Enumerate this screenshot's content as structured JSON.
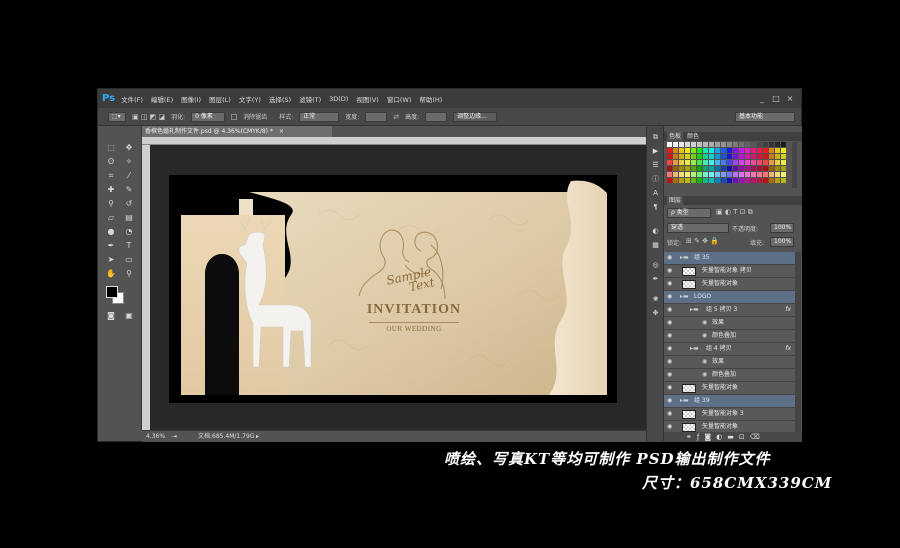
{
  "app": {
    "logo": "Ps"
  },
  "menu": [
    "文件(F)",
    "编辑(E)",
    "图像(I)",
    "图层(L)",
    "文字(Y)",
    "选择(S)",
    "滤镜(T)",
    "3D(D)",
    "视图(V)",
    "窗口(W)",
    "帮助(H)"
  ],
  "window_controls": {
    "minimize": "_",
    "maximize": "□",
    "close": "×"
  },
  "options": {
    "feather_label": "羽化:",
    "feather_value": "0 像素",
    "antialias_label": "消除锯齿",
    "style_label": "样式:",
    "style_value": "正常",
    "width_label": "宽度:",
    "height_label": "高度:",
    "refine_edge": "调整边缘...",
    "workspace": "基本功能"
  },
  "document": {
    "tab_title": "香槟色婚礼制作文件.psd @ 4.36%(CMYK/8) *",
    "zoom": "4.36%",
    "doc_info": "文档:685.4M/1.79G"
  },
  "artwork": {
    "script_line1": "Sample",
    "script_line2": "Text",
    "title": "INVITATION",
    "subtitle": "OUR WEDDING"
  },
  "color_panel": {
    "tabs": [
      "色板",
      "颜色"
    ]
  },
  "layers_panel": {
    "tab": "图层",
    "filter_kind": "ρ 类型",
    "blend_mode": "穿透",
    "opacity_label": "不透明度:",
    "opacity_value": "100%",
    "lock_label": "锁定:",
    "fill_label": "填充:",
    "fill_value": "100%",
    "layers": [
      {
        "name": "组 35",
        "type": "group",
        "selected": true
      },
      {
        "name": "矢量智能对象 拷贝",
        "type": "layer"
      },
      {
        "name": "矢量智能对象",
        "type": "layer"
      },
      {
        "name": "LOGO",
        "type": "group",
        "selected": true
      },
      {
        "name": "组 5 拷贝 3",
        "type": "group",
        "fx": "fx"
      },
      {
        "name": "效果",
        "type": "effect"
      },
      {
        "name": "颜色叠加",
        "type": "effect"
      },
      {
        "name": "组 4 拷贝",
        "type": "group",
        "fx": "fx"
      },
      {
        "name": "效果",
        "type": "effect"
      },
      {
        "name": "颜色叠加",
        "type": "effect"
      },
      {
        "name": "矢量智能对象",
        "type": "layer"
      },
      {
        "name": "组 39",
        "type": "group",
        "selected": true
      },
      {
        "name": "矢量智能对象 3",
        "type": "layer"
      },
      {
        "name": "矢量智能对象",
        "type": "layer"
      }
    ]
  },
  "footer": {
    "line1": "喷绘、写真KT等均可制作  PSD输出制作文件",
    "line2": "尺寸：658CMX339CM"
  },
  "colors": {
    "ps_blue": "#31a8ff",
    "champagne": "#e2cfae",
    "gold_text": "#8a6a3c",
    "selected_layer": "#5e6f88"
  }
}
